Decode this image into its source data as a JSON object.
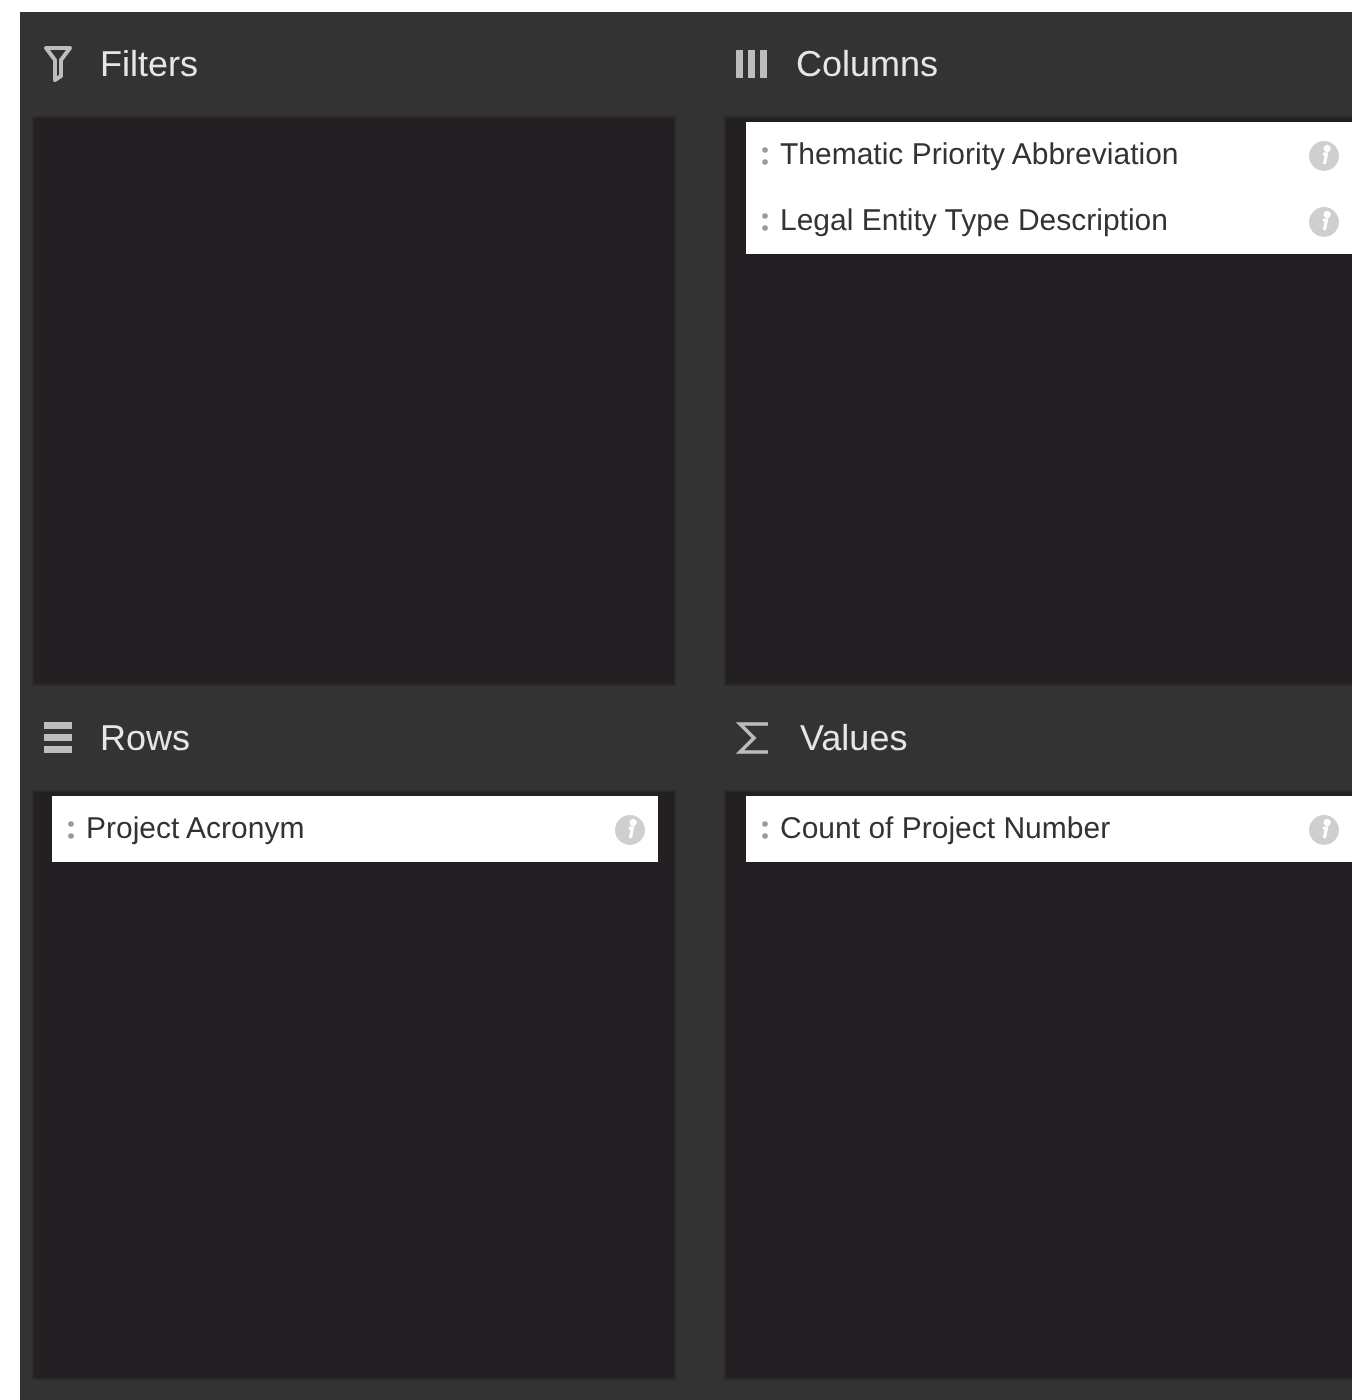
{
  "areas": [
    {
      "kind": "filters",
      "title": "Filters"
    },
    {
      "kind": "columns",
      "title": "Columns",
      "fields": [
        "Thematic Priority Abbreviation",
        "Legal Entity Type Description"
      ]
    },
    {
      "kind": "rows",
      "title": "Rows",
      "fields": [
        "Project Acronym"
      ]
    },
    {
      "kind": "values",
      "title": "Values",
      "fields": [
        "Count of Project Number"
      ]
    }
  ]
}
